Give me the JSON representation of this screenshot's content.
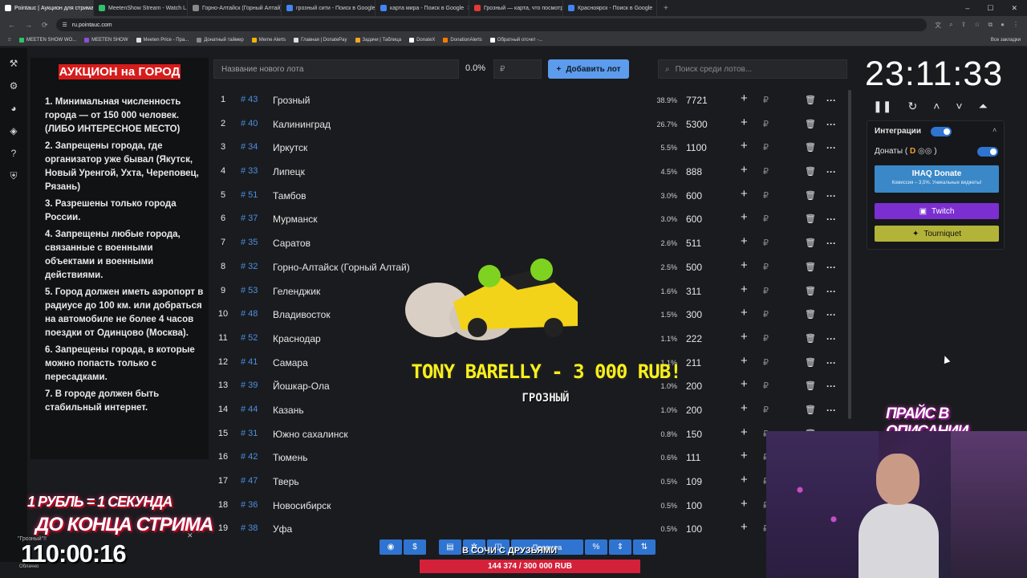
{
  "browser": {
    "tabs": [
      {
        "label": "Pointauc | Аукцион для стрима",
        "color": "#ffffff",
        "active": true
      },
      {
        "label": "MeetenShow Stream - Watch L...",
        "color": "#2ec26b",
        "active": false
      },
      {
        "label": "Горно-Алтайск (Горный Алтай)",
        "color": "#8a8a8a",
        "active": false
      },
      {
        "label": "грозный сити - Поиск в Google",
        "color": "#4285f4",
        "active": false
      },
      {
        "label": "карта мира - Поиск в Google",
        "color": "#4285f4",
        "active": false
      },
      {
        "label": "Грозный — карта, что посмотр...",
        "color": "#e53935",
        "active": false
      },
      {
        "label": "Красноярск - Поиск в Google",
        "color": "#4285f4",
        "active": false
      }
    ],
    "url": "ru.pointauc.com",
    "bookmarks": [
      {
        "label": "MEETEN SHOW WO...",
        "color": "#2ec26b"
      },
      {
        "label": "MEETEN SHOW",
        "color": "#8a4fd6"
      },
      {
        "label": "Meeten Price - Пра...",
        "color": "#e0e0e0"
      },
      {
        "label": "Донатный таймер",
        "color": "#888888"
      },
      {
        "label": "Meme Alerts",
        "color": "#f0b400"
      },
      {
        "label": "Главная | DonatePay",
        "color": "#dddddd"
      },
      {
        "label": "Задачи | Таблица",
        "color": "#f5a623"
      },
      {
        "label": "DonateX",
        "color": "#ffffff"
      },
      {
        "label": "DonationAlerts",
        "color": "#f57c00"
      },
      {
        "label": "Обратный отсчет -...",
        "color": "#ffffff"
      }
    ],
    "all_bookmarks": "Все закладки"
  },
  "rules": {
    "title": "АУКЦИОН на ГОРОД",
    "items": [
      "1. Минимальная численность города — от 150 000 человек. (ЛИБО ИНТЕРЕСНОЕ МЕСТО)",
      "2. Запрещены города, где организатор уже бывал (Якутск, Новый Уренгой, Ухта, Череповец, Рязань)",
      "3. Разрешены только города России.",
      "4. Запрещены любые города, связанные с военными объектами и военными действиями.",
      "5. Город должен иметь аэропорт в радиусе до 100 км. или добраться на автомобиле не более 4 часов поездки от Одинцово (Москва).",
      "6. Запрещены города, в которые можно попасть только с пересадками.",
      "7. В городе должен быть стабильный интернет."
    ]
  },
  "toolbar": {
    "lot_placeholder": "Название нового лота",
    "percent": "0.0%",
    "currency": "₽",
    "add_label": "Добавить лот",
    "search_placeholder": "Поиск среди лотов..."
  },
  "lots": [
    {
      "idx": "1",
      "id": "# 43",
      "name": "Грозный",
      "pct": "38.9%",
      "amount": "7721"
    },
    {
      "idx": "2",
      "id": "# 40",
      "name": "Калининград",
      "pct": "26.7%",
      "amount": "5300"
    },
    {
      "idx": "3",
      "id": "# 34",
      "name": "Иркутск",
      "pct": "5.5%",
      "amount": "1100"
    },
    {
      "idx": "4",
      "id": "# 33",
      "name": "Липецк",
      "pct": "4.5%",
      "amount": "888"
    },
    {
      "idx": "5",
      "id": "# 51",
      "name": "Тамбов",
      "pct": "3.0%",
      "amount": "600"
    },
    {
      "idx": "6",
      "id": "# 37",
      "name": "Мурманск",
      "pct": "3.0%",
      "amount": "600"
    },
    {
      "idx": "7",
      "id": "# 35",
      "name": "Саратов",
      "pct": "2.6%",
      "amount": "511"
    },
    {
      "idx": "8",
      "id": "# 32",
      "name": "Горно-Алтайск (Горный Алтай)",
      "pct": "2.5%",
      "amount": "500"
    },
    {
      "idx": "9",
      "id": "# 53",
      "name": "Геленджик",
      "pct": "1.6%",
      "amount": "311"
    },
    {
      "idx": "10",
      "id": "# 48",
      "name": "Владивосток",
      "pct": "1.5%",
      "amount": "300"
    },
    {
      "idx": "11",
      "id": "# 52",
      "name": "Краснодар",
      "pct": "1.1%",
      "amount": "222"
    },
    {
      "idx": "12",
      "id": "# 41",
      "name": "Самара",
      "pct": "1.1%",
      "amount": "211"
    },
    {
      "idx": "13",
      "id": "# 39",
      "name": "Йошкар-Ола",
      "pct": "1.0%",
      "amount": "200"
    },
    {
      "idx": "14",
      "id": "# 44",
      "name": "Казань",
      "pct": "1.0%",
      "amount": "200"
    },
    {
      "idx": "15",
      "id": "# 31",
      "name": "Южно сахалинск",
      "pct": "0.8%",
      "amount": "150"
    },
    {
      "idx": "16",
      "id": "# 42",
      "name": "Тюмень",
      "pct": "0.6%",
      "amount": "111"
    },
    {
      "idx": "17",
      "id": "# 47",
      "name": "Тверь",
      "pct": "0.5%",
      "amount": "109"
    },
    {
      "idx": "18",
      "id": "# 36",
      "name": "Новосибирск",
      "pct": "0.5%",
      "amount": "100"
    },
    {
      "idx": "19",
      "id": "# 38",
      "name": "Уфа",
      "pct": "0.5%",
      "amount": "100"
    }
  ],
  "timer": {
    "value": "23:11:33"
  },
  "integrations": {
    "header": "Интеграции",
    "donations_label": "Донаты (",
    "ihaq_title": "IHAQ Donate",
    "ihaq_sub": "Комиссия – 3,5%. Уникальные виджеты!",
    "twitch": "Twitch",
    "tourniquet": "Tourniquet"
  },
  "alert": {
    "title": "TONY BARELLY - 3 000 RUB!",
    "subtitle": "ГРОЗНЫЙ"
  },
  "overlay": {
    "price_desc": "ПРАЙС В ОПИСАНИИ",
    "promo_line1": "1 РУБЛЬ = 1 СЕКУНДА",
    "promo_line2": "ДО КОНЦА СТРИМА",
    "chip": "\"Грозный\"!!",
    "stream_timer": "110:00:16",
    "sochi": "В СОЧИ С ДРУЗЬЯМИ",
    "goal": "144 374 / 300 000 RUB",
    "bottom_label": "Правила",
    "weather": "Облачно"
  }
}
